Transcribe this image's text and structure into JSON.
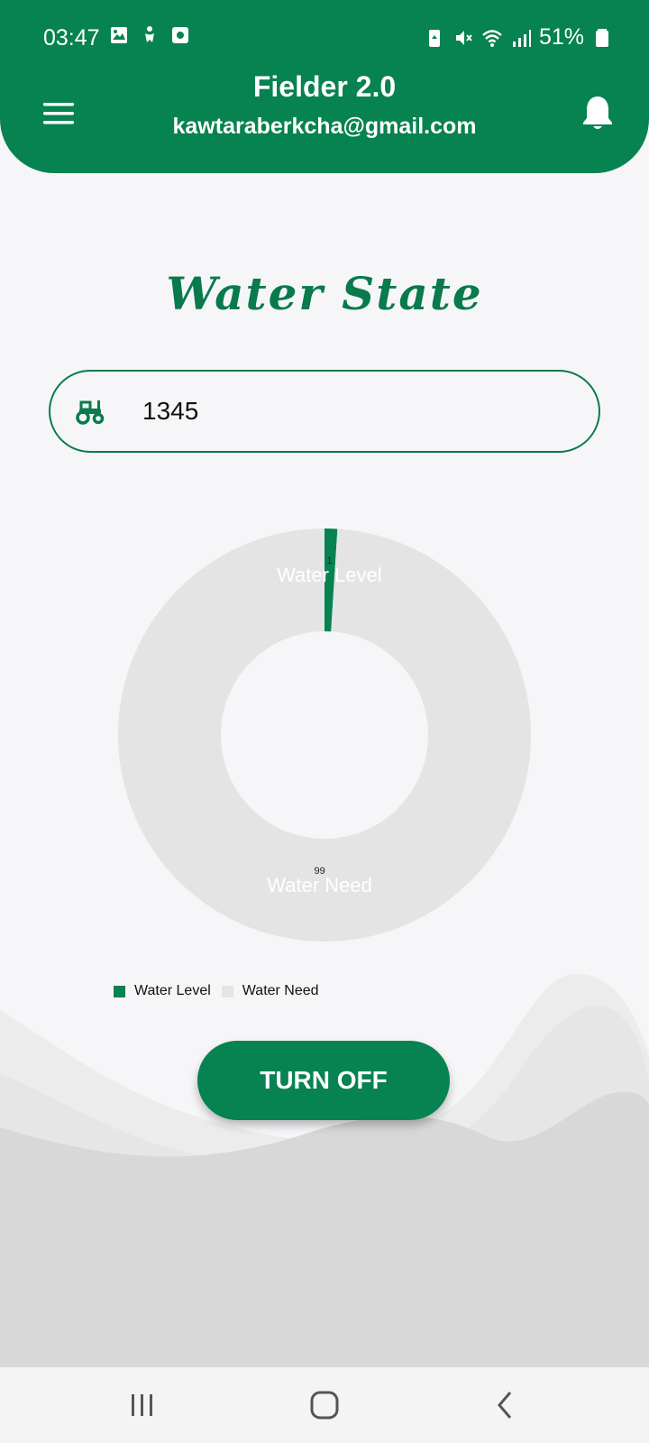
{
  "status_bar": {
    "time": "03:47",
    "battery_percent": "51%",
    "left_icons": [
      "gallery-icon",
      "accessibility-icon",
      "screen-record-icon"
    ],
    "right_icons": [
      "battery-saver-icon",
      "mute-icon",
      "wifi-icon",
      "signal-icon",
      "battery-icon"
    ]
  },
  "header": {
    "title": "Fielder 2.0",
    "email": "kawtaraberkcha@gmail.com",
    "menu_icon": "hamburger-menu-icon",
    "notification_icon": "bell-icon"
  },
  "page": {
    "title": "Water State"
  },
  "device_field": {
    "icon": "tractor-icon",
    "value": "1345"
  },
  "chart_data": {
    "type": "pie",
    "donut": true,
    "labels": [
      "Water Level",
      "Water Need"
    ],
    "values": [
      1,
      99
    ],
    "value_labels": [
      "1",
      "99"
    ],
    "colors": [
      "#078251",
      "#e4e4e4"
    ],
    "legend_position": "bottom-left"
  },
  "actions": {
    "turn_off_label": "TURN OFF"
  },
  "nav_bar": {
    "buttons": [
      "recent-apps-icon",
      "home-icon",
      "back-icon"
    ]
  },
  "colors": {
    "primary": "#078251",
    "background": "#f6f6f8"
  }
}
